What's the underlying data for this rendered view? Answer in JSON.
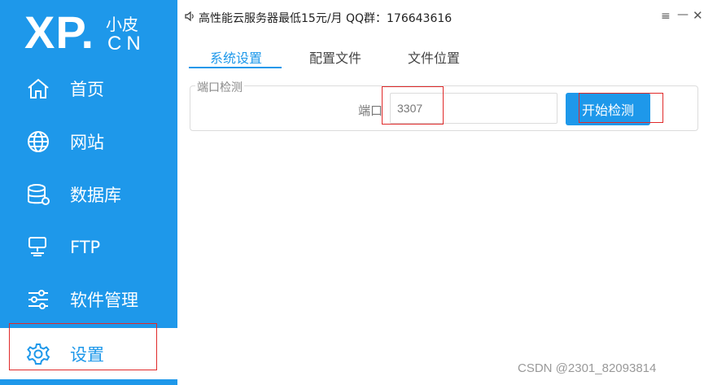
{
  "logo": {
    "main": "XP.",
    "top": "小皮",
    "bottom": "CN"
  },
  "nav": [
    {
      "label": "首页",
      "icon": "home-icon"
    },
    {
      "label": "网站",
      "icon": "globe-icon"
    },
    {
      "label": "数据库",
      "icon": "database-icon"
    },
    {
      "label": "FTP",
      "icon": "ftp-server-icon"
    },
    {
      "label": "软件管理",
      "icon": "sliders-icon"
    },
    {
      "label": "设置",
      "icon": "gear-icon",
      "active": true
    }
  ],
  "topbar": {
    "notice": "高性能云服务器最低15元/月  QQ群：176643616",
    "menu_glyph": "≡",
    "min_glyph": "—",
    "close_glyph": "✕"
  },
  "tabs": [
    "系统设置",
    "配置文件",
    "文件位置"
  ],
  "port_check": {
    "legend": "端口检测",
    "port_label": "端口",
    "port_value": "3307",
    "button_label": "开始检测"
  },
  "watermark": "CSDN @2301_82093814",
  "colors": {
    "accent": "#1e98ea",
    "annotation": "#e02a2a"
  }
}
